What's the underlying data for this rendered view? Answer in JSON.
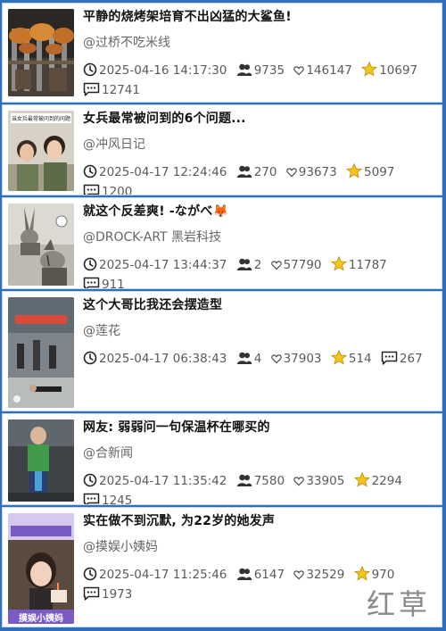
{
  "posts": [
    {
      "title": "平静的烧烤架培育不出凶猛的大鲨鱼!",
      "author": "@过桥不吃米线",
      "time": "2025-04-16 14:17:30",
      "comments": "9735",
      "likes": "146147",
      "stars": "10697",
      "shares": "12741",
      "thumb_desc": "grilled fish on skewers"
    },
    {
      "title": "女兵最常被问到的6个问题...",
      "author": "@冲风日记",
      "time": "2025-04-17 12:24:46",
      "comments": "270",
      "likes": "93673",
      "stars": "5097",
      "shares": "1200",
      "thumb_text": "当女兵最常被问到的问题",
      "thumb_desc": "two women selfie"
    },
    {
      "title": "就这个反差爽! -ながべ🦊",
      "author": "@DROCK-ART 黑岩科技",
      "time": "2025-04-17 13:44:37",
      "comments": "2",
      "likes": "57790",
      "stars": "11787",
      "shares": "911",
      "thumb_desc": "rabbit character comic"
    },
    {
      "title": "这个大哥比我还会摆造型",
      "author": "@莲花",
      "time": "2025-04-17 06:38:43",
      "comments": "4",
      "likes": "37903",
      "stars": "514",
      "shares": "267",
      "thumb_desc": "man posing on steps"
    },
    {
      "title": "网友: 弱弱问一句保温杯在哪买的",
      "author": "@合新闻",
      "time": "2025-04-17 11:35:42",
      "comments": "7580",
      "likes": "33905",
      "stars": "2294",
      "shares": "1245",
      "thumb_desc": "child with thermos cup"
    },
    {
      "title": "实在做不到沉默, 为22岁的她发声",
      "author": "@摸娱小姨妈",
      "time": "2025-04-17 11:25:46",
      "comments": "6147",
      "likes": "32529",
      "stars": "970",
      "shares": "1973",
      "thumb_text": "摸娱小姨妈",
      "thumb_desc": "girl with birthday cake"
    }
  ],
  "watermark": "红草",
  "icons": {
    "time": "clock-icon",
    "comments": "users-icon",
    "likes": "heart-icon",
    "stars": "star-icon",
    "shares": "chat-icon"
  },
  "colors": {
    "background": "#2e6fbe",
    "card": "#ffffff",
    "star": "#f5c518"
  }
}
